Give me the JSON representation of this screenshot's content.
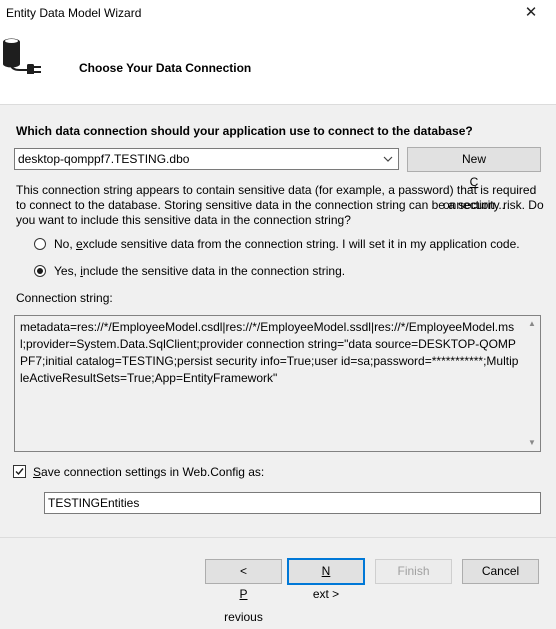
{
  "window": {
    "title": "Entity Data Model Wizard",
    "close_glyph": "✕"
  },
  "banner": {
    "title": "Choose Your Data Connection",
    "icon": "database-plug-icon"
  },
  "question": "Which data connection should your application use to connect to the database?",
  "connection": {
    "selected": "desktop-qomppf7.TESTING.dbo",
    "new_button": {
      "pre": "New ",
      "mnemonic": "C",
      "post": "onnection..."
    }
  },
  "warning": "This connection string appears to contain sensitive data (for example, a password) that is required to connect to the database. Storing sensitive data in the connection string can be a security risk. Do you want to include this sensitive data in the connection string?",
  "options": {
    "exclude": {
      "pre": "No, ",
      "mnemonic": "e",
      "post": "xclude sensitive data from the connection string. I will set it in my application code.",
      "checked": false
    },
    "include": {
      "pre": "Yes, ",
      "mnemonic": "i",
      "post": "nclude the sensitive data in the connection string.",
      "checked": true
    }
  },
  "connection_string": {
    "label": "Connection string:",
    "value": "metadata=res://*/EmployeeModel.csdl|res://*/EmployeeModel.ssdl|res://*/EmployeeModel.msl;provider=System.Data.SqlClient;provider connection string=\"data source=DESKTOP-QOMPPF7;initial catalog=TESTING;persist security info=True;user id=sa;password=***********;MultipleActiveResultSets=True;App=EntityFramework\""
  },
  "save_settings": {
    "checked": true,
    "mnemonic": "S",
    "post": "ave connection settings in Web.Config as:",
    "value": "TESTINGEntities"
  },
  "buttons": {
    "previous": {
      "pre": "< ",
      "mnemonic": "P",
      "post": "revious"
    },
    "next": {
      "pre": "",
      "mnemonic": "N",
      "post": "ext >"
    },
    "finish": {
      "label": "Finish"
    },
    "cancel": {
      "label": "Cancel"
    }
  },
  "colors": {
    "accent": "#0078d7",
    "background": "#f0f0f0"
  }
}
